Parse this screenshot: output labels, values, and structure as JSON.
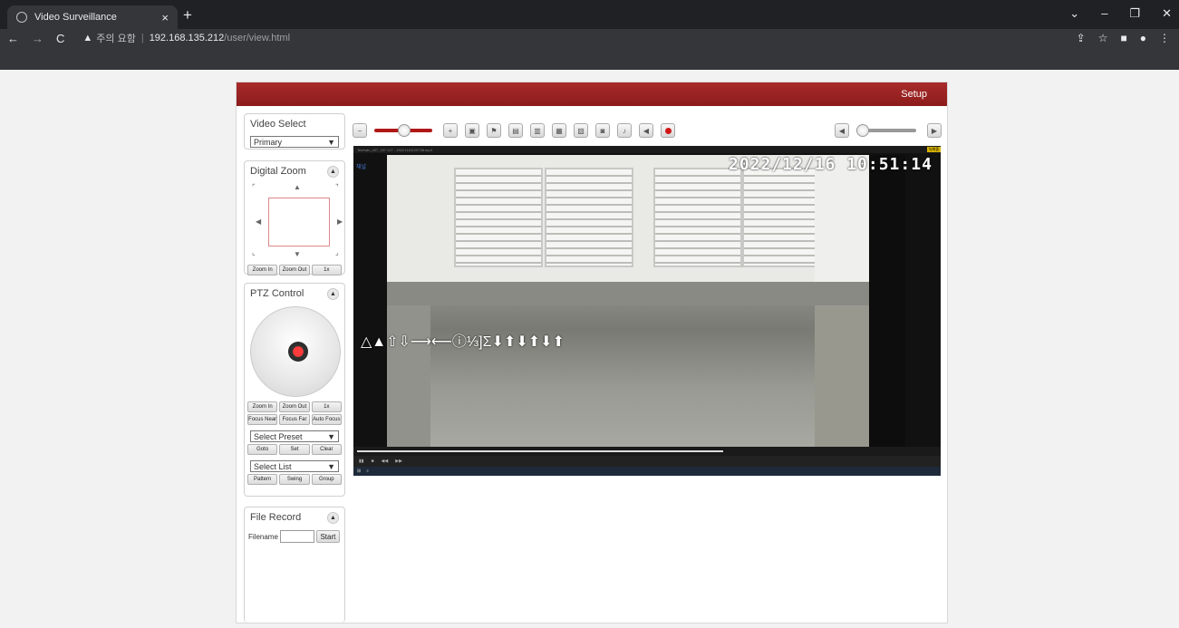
{
  "browser": {
    "tab_title": "Video Surveillance",
    "tab_close": "×",
    "new_tab": "+",
    "security_warning": "주의 요함",
    "url_host": "192.168.135.212",
    "url_path": "/user/view.html"
  },
  "header": {
    "setup_label": "Setup"
  },
  "video_select": {
    "title": "Video Select",
    "selected": "Primary"
  },
  "digital_zoom": {
    "title": "Digital Zoom",
    "zoom_in": "Zoom In",
    "zoom_out": "Zoom Out",
    "one_x": "1x"
  },
  "ptz": {
    "title": "PTZ Control",
    "zoom_in": "Zoom In",
    "zoom_out": "Zoom Out",
    "one_x": "1x",
    "focus_near": "Focus Near",
    "focus_far": "Focus Far",
    "auto_focus": "Auto Focus",
    "preset_selected": "Select Preset",
    "goto": "Goto",
    "set": "Set",
    "clear": "Clear",
    "list_selected": "Select List",
    "pattern": "Pattern",
    "swing": "Swing",
    "group": "Group"
  },
  "file_record": {
    "title": "File Record",
    "filename_label": "Filename",
    "start_label": "Start"
  },
  "video": {
    "timestamp": "2022/12/16 10:51:14",
    "channel_label": "채널",
    "overlay_glyphs": "△▲⇧⇩⟶⟵ⓘ⅓]Σ⬇⬆⬇⬆⬇⬆",
    "top_bar_text": "Techwin_x57_157.127 - 20221116120738.mp4",
    "badge": "녹화중"
  }
}
